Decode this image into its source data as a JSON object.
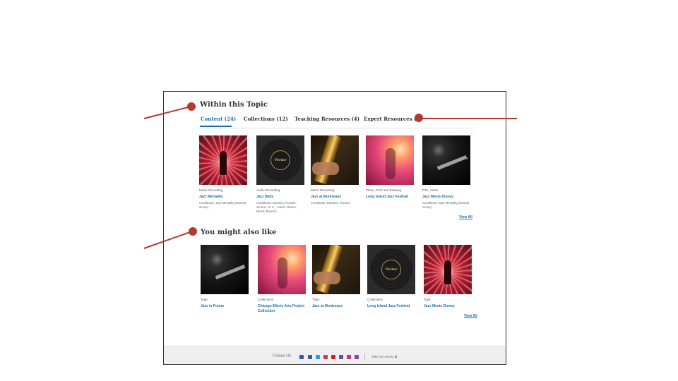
{
  "section1": {
    "title": "Within this Topic",
    "tabs": [
      {
        "label": "Content (24)",
        "active": true
      },
      {
        "label": "Collections (12)",
        "active": false
      },
      {
        "label": "Teaching Resources (4)",
        "active": false
      },
      {
        "label": "Expert Resources (2)",
        "active": false
      }
    ],
    "items": [
      {
        "art": "red",
        "type": "Music Recording",
        "title": "Jazz Mentality",
        "contributor": "Contributor: Jazz Mentality (Musical Group)"
      },
      {
        "art": "record",
        "record_label": "Victor",
        "type": "Audio Recording",
        "title": "Jazz Baby",
        "contributor": "Contributor: Bourdon, Rosario ; Jerome, M. K. ; Harris, Marion ; Merrill, Blanche"
      },
      {
        "art": "sax",
        "type": "Music Recording",
        "title": "Jazz at Montreaux",
        "contributor": "Contributor: Bearden, Romare"
      },
      {
        "art": "pink",
        "type": "Photo, Print and Drawing",
        "title": "Long Island Jazz Festival",
        "contributor": ""
      },
      {
        "art": "dark",
        "type": "Film, Video",
        "title": "Jazz Meets Disney",
        "contributor": "Contributor: Jazz Mentality (Musical Group)"
      }
    ],
    "next_arrow": "›",
    "view_all": "View All"
  },
  "section2": {
    "title": "You might also like",
    "items": [
      {
        "art": "dark",
        "type": "Topic",
        "title": "Jazz in Future"
      },
      {
        "art": "pink",
        "type": "Collections",
        "title": "Chicago Ethnic Arts Project Collection"
      },
      {
        "art": "sax",
        "type": "Topic",
        "title": "Jazz at Montreaux"
      },
      {
        "art": "record",
        "record_label": "Victor",
        "type": "Collections",
        "title": "Long Island Jazz Festival"
      },
      {
        "art": "red",
        "type": "Topic",
        "title": "Jazz Meets Disney"
      }
    ],
    "next_arrow": "›",
    "view_all": "View All"
  },
  "footer": {
    "follow_label": "Follow Us",
    "social_icons": [
      {
        "name": "twitter-icon",
        "color": "#2a5aa8"
      },
      {
        "name": "facebook-icon",
        "color": "#3b5998"
      },
      {
        "name": "twitter-bird-icon",
        "color": "#1da1f2"
      },
      {
        "name": "youtube-icon",
        "color": "#d03b3b"
      },
      {
        "name": "pinterest-icon",
        "color": "#cb2027"
      },
      {
        "name": "flickr-icon",
        "color": "#7a44a8"
      },
      {
        "name": "instagram-icon",
        "color": "#c13584"
      },
      {
        "name": "podcast-icon",
        "color": "#8e44ad"
      }
    ],
    "survey_label": "Take our survey ⧉"
  },
  "annotation_color": "#b23a2e"
}
